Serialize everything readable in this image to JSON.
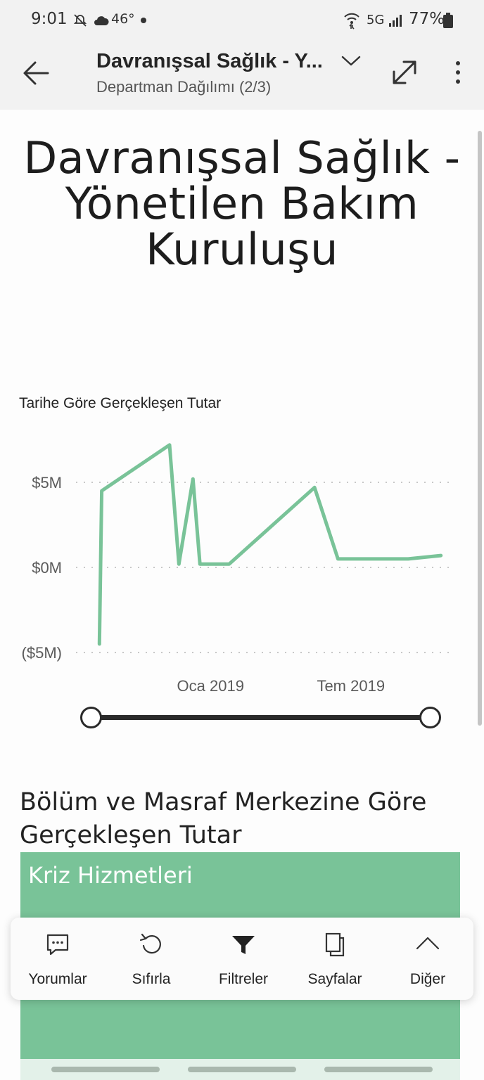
{
  "status_bar": {
    "time": "9:01",
    "temperature": "46°",
    "network": "5G",
    "battery": "77%"
  },
  "app_bar": {
    "title": "Davranışsal Sağlık - Y...",
    "subtitle": "Departman Dağılımı (2/3)"
  },
  "report": {
    "title": "Davranışsal Sağlık - Yönetilen Bakım Kuruluşu",
    "chart_title": "Tarihe Göre Gerçekleşen Tutar",
    "section_title": "Bölüm ve Masraf Merkezine Göre Gerçekleşen Tutar",
    "card_label": "Kriz Hizmetleri",
    "accent_color": "#79c398"
  },
  "chart_data": {
    "type": "line",
    "title": "Tarihe Göre Gerçekleşen Tutar",
    "y_tick_labels": [
      "$5M",
      "$0M",
      "($5M)"
    ],
    "x_tick_labels": [
      "Oca 2019",
      "Tem 2019"
    ],
    "ylim": [
      -5,
      5
    ],
    "y_unit": "$M",
    "grid": true,
    "series": [
      {
        "color": "#79c398",
        "x": [
          "2018-09",
          "2018-09",
          "2018-12",
          "2018-12",
          "2019-01",
          "2019-01",
          "2019-02",
          "2019-06",
          "2019-07",
          "2019-10",
          "2019-11"
        ],
        "values": [
          -4.5,
          4.5,
          7.2,
          0.2,
          5.2,
          0.2,
          0.2,
          4.7,
          0.5,
          0.5,
          0.7
        ]
      }
    ]
  },
  "toolbar": {
    "items": [
      {
        "label": "Yorumlar",
        "icon": "comment-icon"
      },
      {
        "label": "Sıfırla",
        "icon": "reset-icon"
      },
      {
        "label": "Filtreler",
        "icon": "filter-icon"
      },
      {
        "label": "Sayfalar",
        "icon": "pages-icon"
      },
      {
        "label": "Diğer",
        "icon": "chevron-up-icon"
      }
    ]
  }
}
